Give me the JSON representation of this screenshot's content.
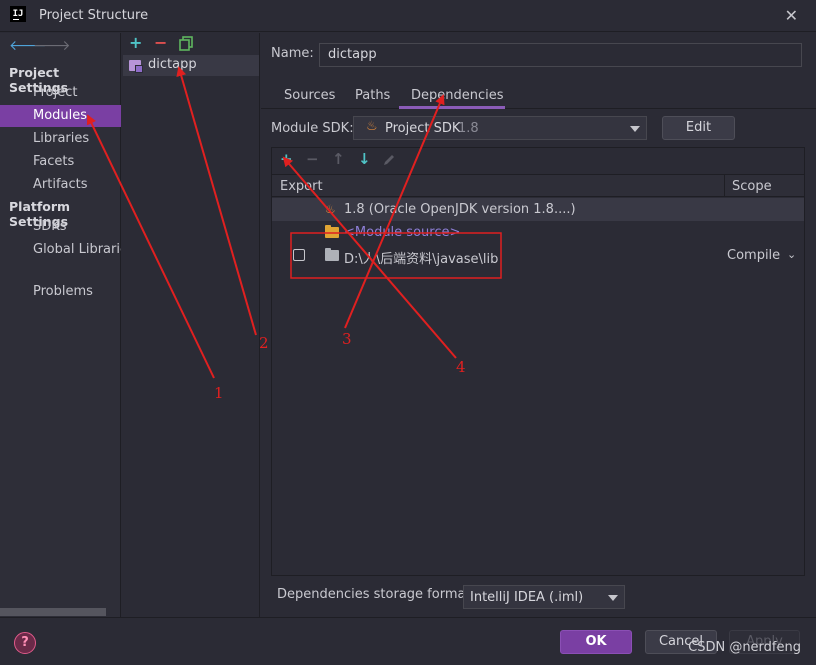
{
  "window": {
    "logo": "IJ",
    "title": "Project Structure",
    "close": "✕"
  },
  "sidebar": {
    "back": "🡐",
    "forward": "🡒",
    "project_settings_header": "Project Settings",
    "project_items": [
      {
        "label": "Project"
      },
      {
        "label": "Modules",
        "selected": true
      },
      {
        "label": "Libraries"
      },
      {
        "label": "Facets"
      },
      {
        "label": "Artifacts"
      }
    ],
    "platform_settings_header": "Platform Settings",
    "platform_items": [
      {
        "label": "SDKs"
      },
      {
        "label": "Global Libraries"
      }
    ],
    "problems": "Problems"
  },
  "modules": {
    "toolbar": {
      "add": "+",
      "remove": "−",
      "copy_icon": "copy-icon"
    },
    "items": [
      {
        "name": "dictapp"
      }
    ]
  },
  "main": {
    "name_label": "Name:",
    "name_value": "dictapp",
    "tabs": [
      {
        "label": "Sources"
      },
      {
        "label": "Paths"
      },
      {
        "label": "Dependencies",
        "active": true
      }
    ],
    "module_sdk_label": "Module SDK:",
    "module_sdk_value": "Project SDK",
    "module_sdk_version": "1.8",
    "edit_button": "Edit",
    "deps_toolbar": {
      "add": "+",
      "remove": "−",
      "up": "↑",
      "down": "↓",
      "edit_icon": "pencil-icon"
    },
    "deps_columns": {
      "export": "Export",
      "scope": "Scope"
    },
    "deps_rows": [
      {
        "text": "1.8 (Oracle OpenJDK version 1.8....)",
        "icon": "java-icon",
        "scope": ""
      },
      {
        "text": "<Module source>",
        "icon": "folder-icon",
        "scope": ""
      },
      {
        "text": "D:\\人\\后端资料\\javase\\lib",
        "icon": "folder-icon",
        "scope": "Compile",
        "export_checked": false
      }
    ],
    "storage_format_label": "Dependencies storage format:",
    "storage_format_value": "IntelliJ IDEA (.iml)"
  },
  "footer": {
    "help": "?",
    "ok": "OK",
    "cancel": "Cancel",
    "apply": "Apply",
    "watermark": "CSDN @nerdfeng"
  },
  "annotations": {
    "labels": [
      "1",
      "2",
      "3",
      "4"
    ],
    "color": "#e02020"
  },
  "colors": {
    "accent": "#7a3fa3",
    "background": "#2b2b35",
    "annotation": "#e02020"
  }
}
